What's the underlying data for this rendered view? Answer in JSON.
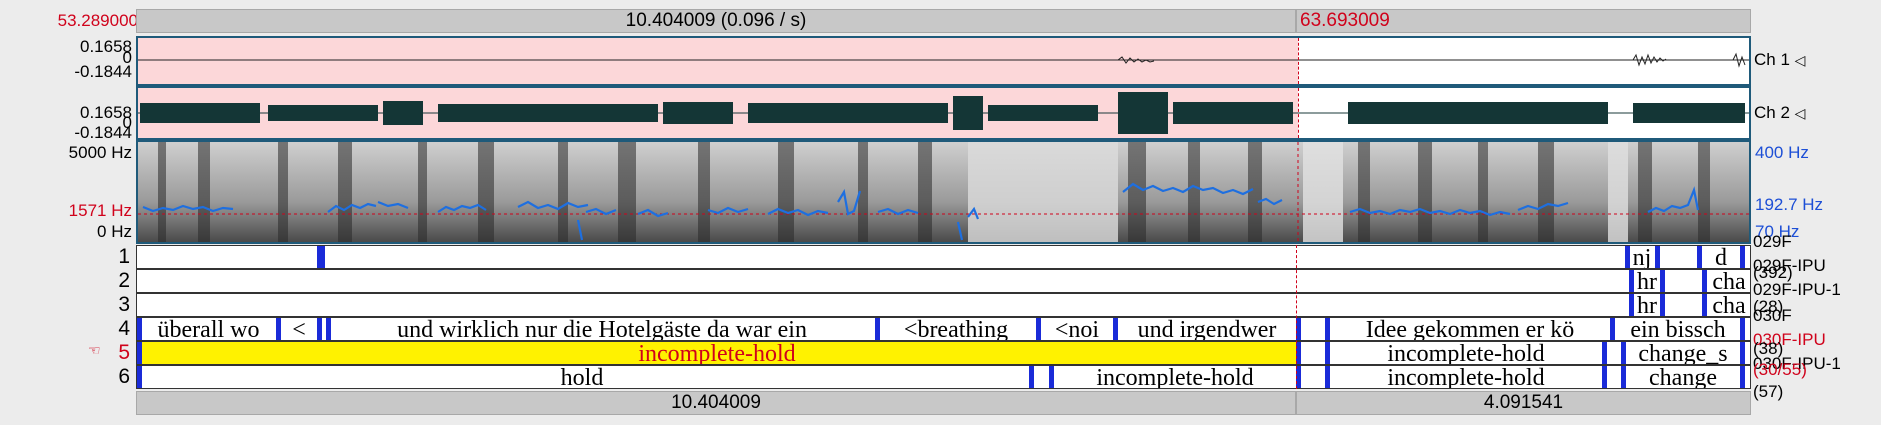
{
  "top_bar": {
    "start_time": "53.289000",
    "selection_label": "10.404009 (0.096 / s)",
    "cursor_time": "63.693009"
  },
  "waveform": {
    "ch1": {
      "max": "0.1658",
      "zero": "0",
      "min": "-0.1844",
      "label": "Ch 1"
    },
    "ch2": {
      "max": "0.1658",
      "zero": "0",
      "min": "-0.1844",
      "label": "Ch 2"
    }
  },
  "spectrogram": {
    "freq_top": "5000 Hz",
    "freq_cursor": "1571 Hz",
    "freq_bottom": "0 Hz",
    "pitch_top": "400 Hz",
    "pitch_cursor": "192.7 Hz",
    "pitch_bottom": "70 Hz"
  },
  "tiers": [
    {
      "number": "1",
      "side_name": "029F",
      "side_count": "(392)",
      "intervals": [
        {
          "text": "nj"
        },
        {
          "text": "d"
        }
      ]
    },
    {
      "number": "2",
      "side_name": "029F-IPU",
      "side_count": "",
      "intervals": [
        {
          "text": "hr"
        },
        {
          "text": "cha"
        }
      ]
    },
    {
      "number": "3",
      "side_name": "029F-IPU-1",
      "side_count": "",
      "intervals": [
        {
          "text": "hr"
        },
        {
          "text": "cha"
        }
      ]
    },
    {
      "number": "4",
      "side_name": "030F",
      "side_count": "(28)",
      "intervals": [
        {
          "text": "überall wo"
        },
        {
          "text": "<"
        },
        {
          "text": "und wirklich nur die Hotelgäste da war ein"
        },
        {
          "text": "<breathing"
        },
        {
          "text": "<noi"
        },
        {
          "text": "und irgendwer"
        },
        {
          "text": "Idee gekommen er kö"
        },
        {
          "text": "ein bissch"
        }
      ]
    },
    {
      "number": "5",
      "side_name": "030F-IPU",
      "side_count": "(38)",
      "intervals": [
        {
          "text": "incomplete-hold"
        },
        {
          "text": "incomplete-hold"
        },
        {
          "text": "change_s"
        }
      ]
    },
    {
      "number": "6",
      "side_name": "030F-IPU-1",
      "side_count": "(57)",
      "intervals": [
        {
          "text": "hold"
        },
        {
          "text": "incomplete-hold"
        },
        {
          "text": "incomplete-hold"
        },
        {
          "text": "change"
        }
      ]
    }
  ],
  "tier5_extra": "(30/55)",
  "bottom_bar": {
    "selection_duration": "10.404009",
    "remaining_duration": "4.091541"
  }
}
